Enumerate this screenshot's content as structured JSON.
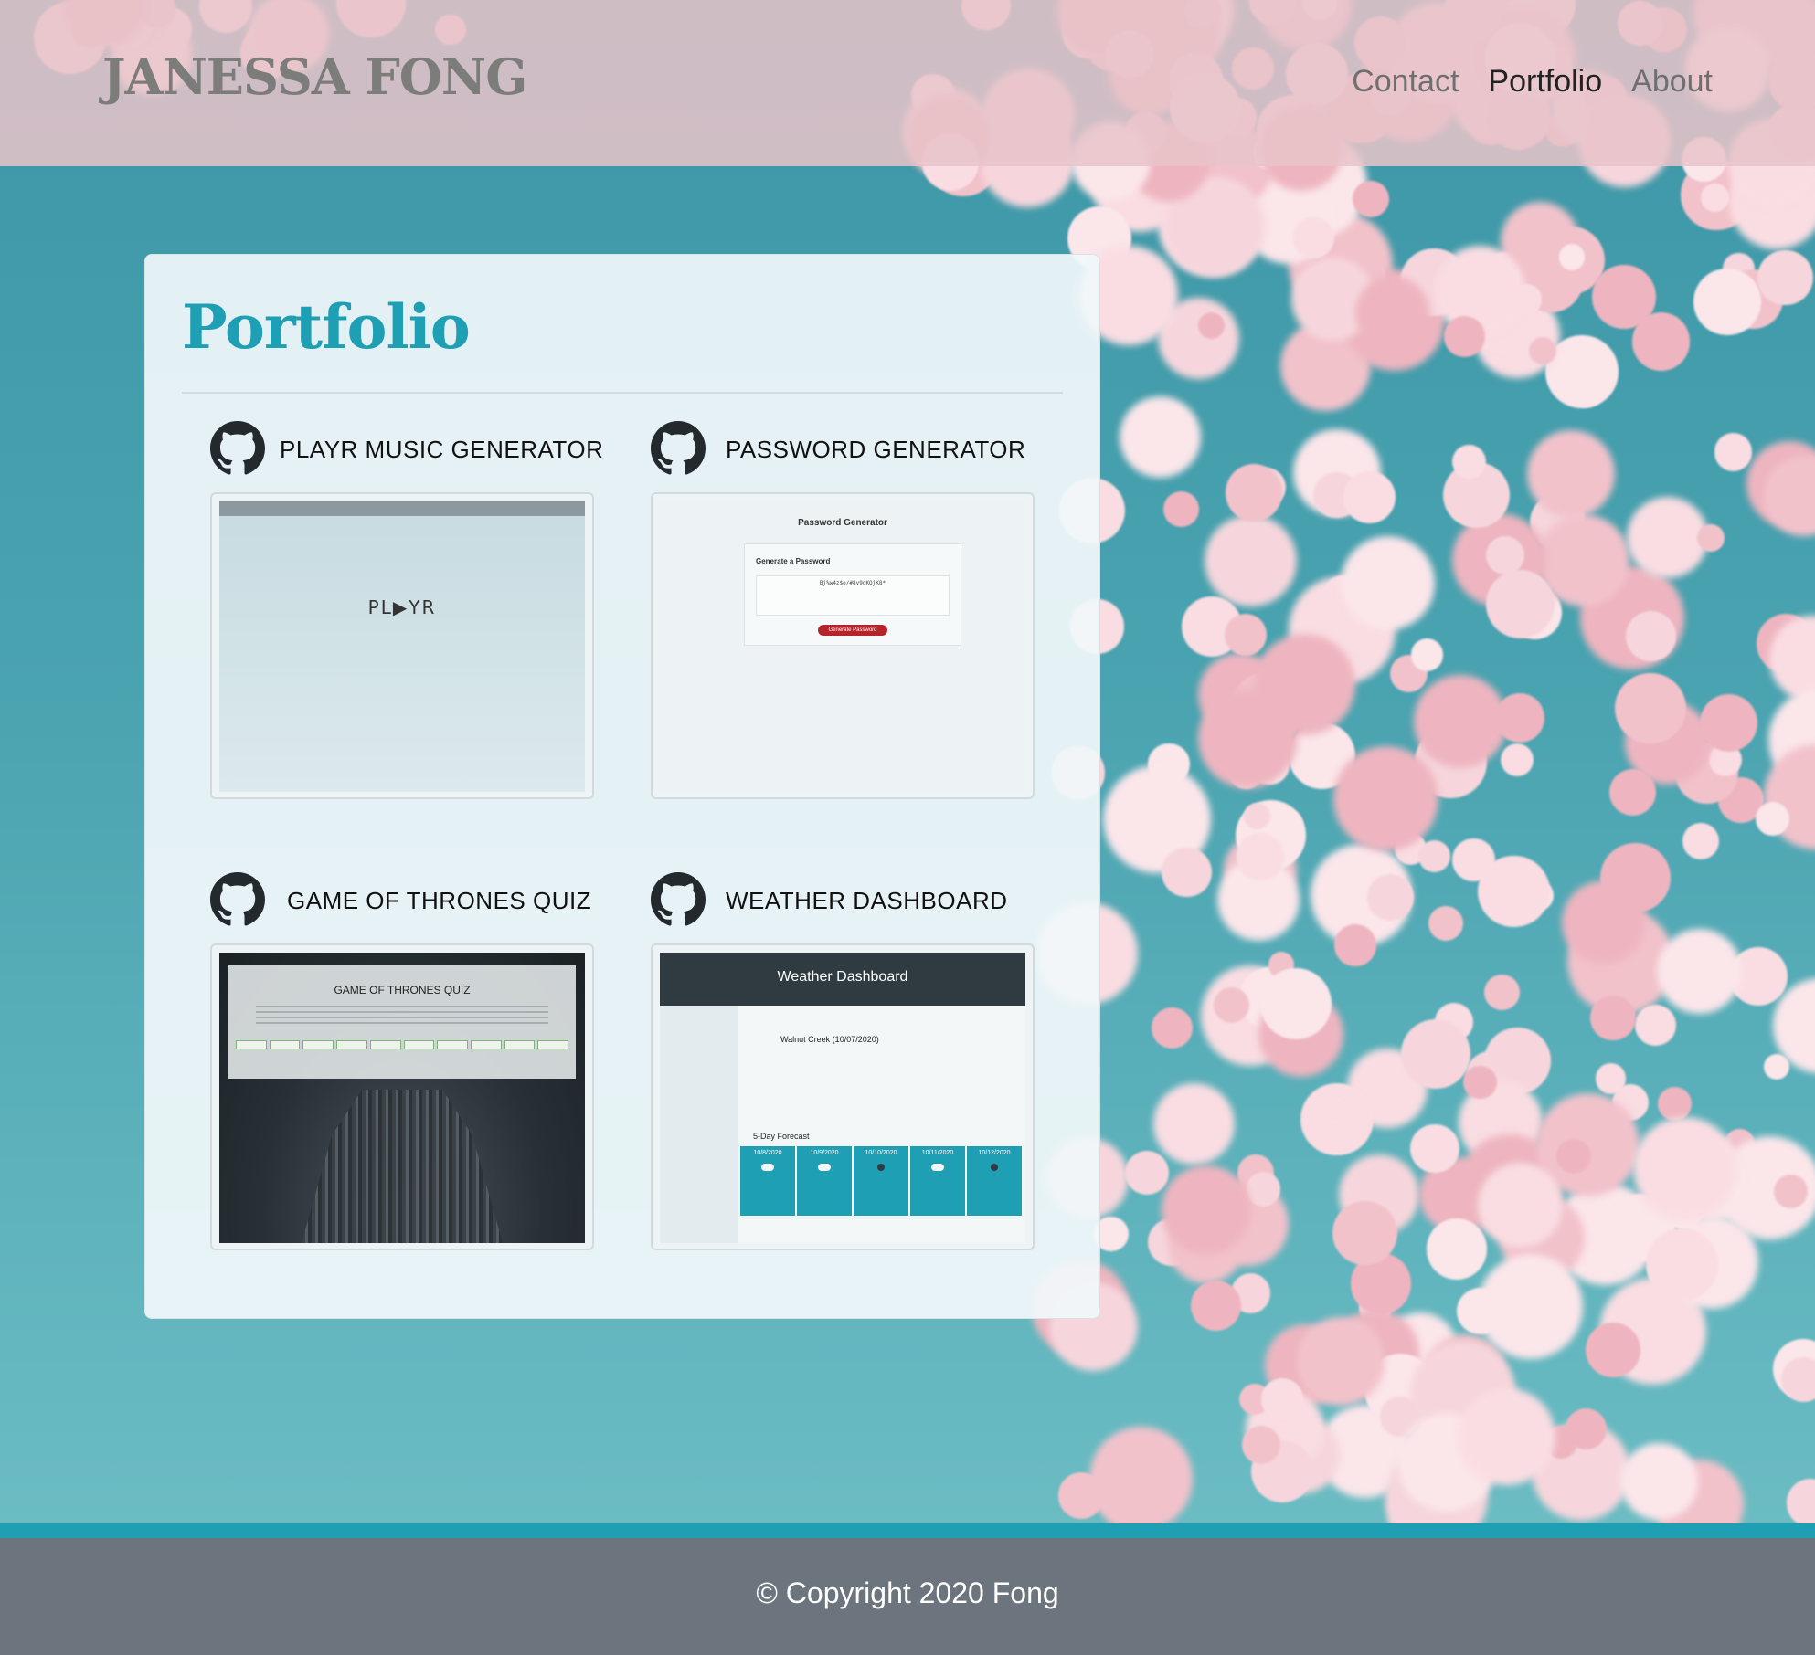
{
  "header": {
    "brand": "JANESSA FONG",
    "nav": [
      {
        "label": "Contact",
        "active": false
      },
      {
        "label": "Portfolio",
        "active": true
      },
      {
        "label": "About",
        "active": false
      }
    ]
  },
  "portfolio": {
    "title": "Portfolio",
    "projects": [
      {
        "title": "PLAYR MUSIC GENERATOR",
        "icon": "github-icon"
      },
      {
        "title": "PASSWORD GENERATOR",
        "icon": "github-icon"
      },
      {
        "title": "GAME OF THRONES QUIZ",
        "icon": "github-icon"
      },
      {
        "title": "WEATHER DASHBOARD",
        "icon": "github-icon"
      }
    ]
  },
  "screenshots": {
    "playr": {
      "logo": "PL▶YR"
    },
    "password": {
      "title": "Password Generator",
      "subtitle": "Generate a Password",
      "value": "Bj%w4z$o/#8v9dKQjK8*",
      "button": "Generate Password"
    },
    "got": {
      "title": "GAME OF THRONES QUIZ"
    },
    "weather": {
      "title": "Weather Dashboard",
      "city": "Walnut Creek (10/07/2020)",
      "forecast_label": "5-Day Forecast",
      "days": [
        "10/8/2020",
        "10/9/2020",
        "10/10/2020",
        "10/11/2020",
        "10/12/2020"
      ]
    }
  },
  "footer": {
    "copyright": "© Copyright 2020 Fong"
  },
  "colors": {
    "accent": "#1f9fb4",
    "footer": "#6c757d",
    "header": "#e8c4ca"
  }
}
